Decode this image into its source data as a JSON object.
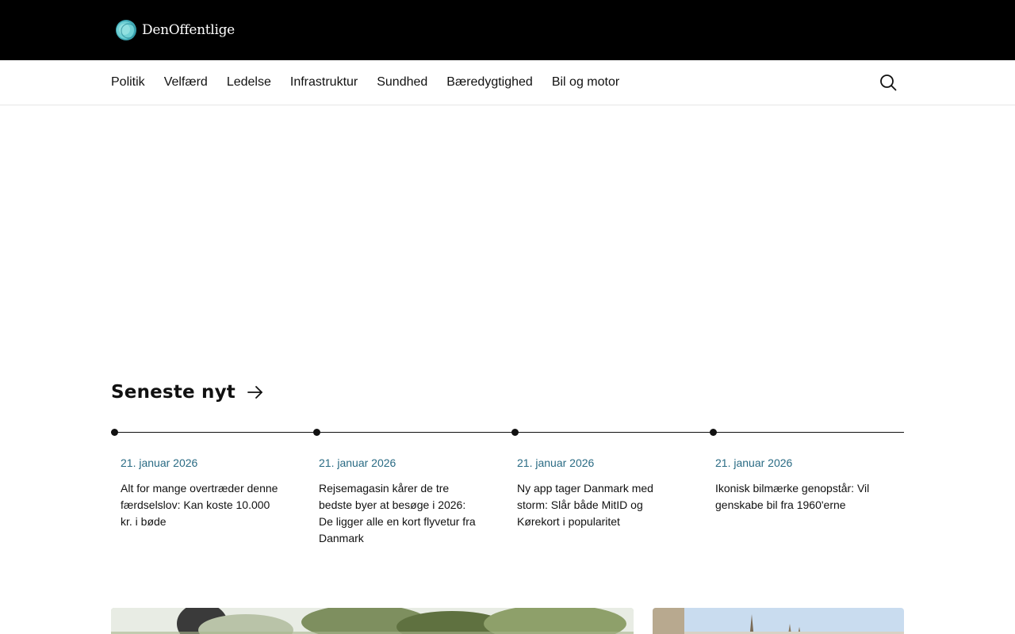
{
  "header": {
    "logo_text": "DenOffentlige"
  },
  "nav": {
    "items": [
      "Politik",
      "Velfærd",
      "Ledelse",
      "Infrastruktur",
      "Sundhed",
      "Bæredygtighed",
      "Bil og motor"
    ]
  },
  "latest": {
    "title": "Seneste nyt",
    "items": [
      {
        "date": "21. januar 2026",
        "title": "Alt for mange overtræder denne færdselslov: Kan koste 10.000 kr. i bøde"
      },
      {
        "date": "21. januar 2026",
        "title": "Rejsemagasin kårer de tre bedste byer at besøge i 2026: De ligger alle en kort flyvetur fra Danmark"
      },
      {
        "date": "21. januar 2026",
        "title": "Ny app tager Danmark med storm: Slår både MitID og Kørekort i popularitet"
      },
      {
        "date": "21. januar 2026",
        "title": "Ikonisk bilmærke genopstår: Vil genskabe bil fra 1960'erne"
      }
    ]
  },
  "colors": {
    "header_bg": "#000000",
    "date_accent": "#2a6b84",
    "logo_accent": "#5fc4c9"
  },
  "icons": {
    "logo": "circle-logo-icon",
    "search": "search-icon",
    "section_arrow": "arrow-right-icon"
  }
}
